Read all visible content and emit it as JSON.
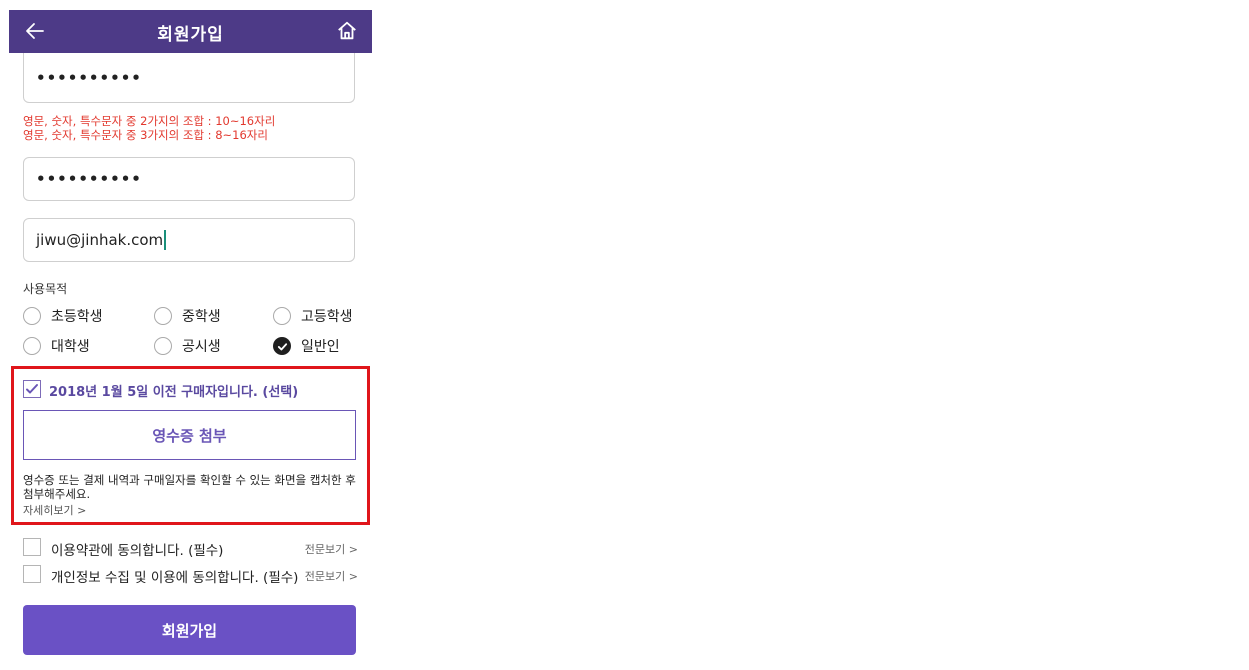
{
  "header": {
    "title": "회원가입",
    "back_icon": "arrow-left-icon",
    "home_icon": "home-icon",
    "bg_color": "#4d3a87"
  },
  "form": {
    "password_value": "••••••••••",
    "password_hint_line1": "영문, 숫자, 특수문자 중 2가지의 조합 : 10~16자리",
    "password_hint_line2": "영문, 숫자, 특수문자 중 3가지의 조합 : 8~16자리",
    "password_confirm_value": "••••••••••",
    "email_value": "jiwu@jinhak.com"
  },
  "purpose": {
    "label": "사용목적",
    "options": [
      {
        "label": "초등학생",
        "selected": false
      },
      {
        "label": "중학생",
        "selected": false
      },
      {
        "label": "고등학생",
        "selected": false
      },
      {
        "label": "대학생",
        "selected": false
      },
      {
        "label": "공시생",
        "selected": false
      },
      {
        "label": "일반인",
        "selected": true
      }
    ]
  },
  "pre_purchase": {
    "label": "2018년 1월 5일 이전 구매자입니다. (선택)",
    "checked": true,
    "receipt_button": "영수증 첨부",
    "description": "영수증 또는 결제 내역과 구매일자를 확인할 수 있는 화면을 캡처한 후 첨부해주세요.",
    "more_link": "자세히보기 >"
  },
  "agreements": [
    {
      "label": "이용약관에 동의합니다. (필수)",
      "link": "전문보기 >",
      "checked": false
    },
    {
      "label": "개인정보 수집 및 이용에 동의합니다. (필수)",
      "link": "전문보기 >",
      "checked": false
    }
  ],
  "submit": {
    "label": "회원가입",
    "color": "#6a51c5"
  },
  "accent_colors": {
    "highlight_border": "#e0161b",
    "hint_text": "#e2382e",
    "purple": "#6a56b6"
  }
}
